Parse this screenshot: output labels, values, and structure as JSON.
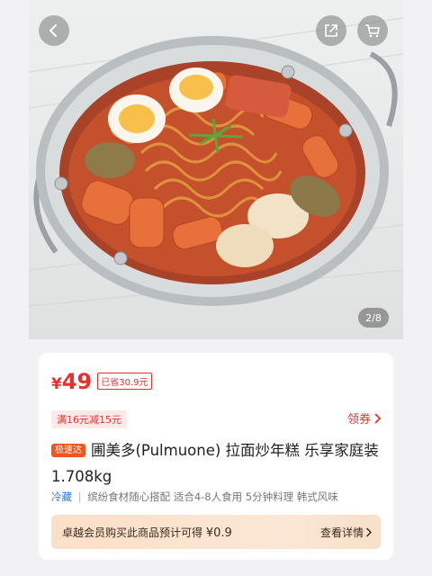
{
  "header": {
    "back_icon": "chevron-left-icon",
    "share_icon": "share-icon",
    "cart_icon": "cart-icon"
  },
  "gallery": {
    "pager": "2/8"
  },
  "product": {
    "currency": "¥",
    "price": "49",
    "saved": "已省30.9元",
    "coupon": "满16元减15元",
    "claim_label": "领券",
    "tag": "极速达",
    "title": "圃美多(Pulmuone) 拉面炒年糕 乐享家庭装 1.708kg",
    "storage": "冷藏",
    "separator": "|",
    "features": "缤纷食材随心搭配 适合4-8人食用 5分钟料理 韩式风味",
    "member_text": "卓越会员购买此商品预计可得",
    "member_currency": "¥",
    "member_amount": "0.9",
    "member_link": "查看详情"
  },
  "colors": {
    "accent": "#e5322d",
    "tag": "#f0551f",
    "storage": "#2f7ad8"
  }
}
